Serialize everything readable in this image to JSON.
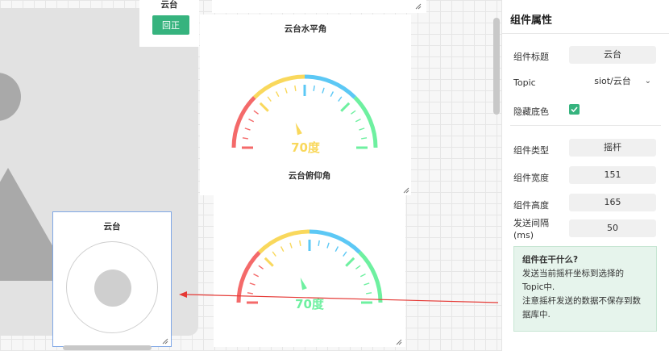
{
  "canvas": {
    "top_card": {
      "title": "云台",
      "reset_label": "回正"
    },
    "gauge_horizontal": {
      "title": "云台水平角",
      "value_text": "70度",
      "value": 70,
      "max": 180
    },
    "gauge_pitch": {
      "title": "云台俯仰角",
      "value_text": "70度",
      "value": 70,
      "max": 180
    },
    "joystick": {
      "title": "云台"
    }
  },
  "panel": {
    "title": "组件属性",
    "component_title": {
      "label": "组件标题",
      "value": "云台"
    },
    "topic": {
      "label": "Topic",
      "value": "siot/云台"
    },
    "hide_bg": {
      "label": "隐藏底色",
      "checked": true
    },
    "component_type": {
      "label": "组件类型",
      "value": "摇杆"
    },
    "width": {
      "label": "组件宽度",
      "value": "151"
    },
    "height": {
      "label": "组件高度",
      "value": "165"
    },
    "interval": {
      "label": "发送间隔",
      "label2": "(ms)",
      "value": "50"
    },
    "help": {
      "title": "组件在干什么?",
      "line1": "发送当前摇杆坐标到选择的",
      "line2": "Topic中.",
      "line3": "注意摇杆发送的数据不保存到数",
      "line4": "据库中."
    }
  },
  "colors": {
    "accent_green": "#36b37e",
    "gauge_red": "#f46a6a",
    "gauge_yellow": "#f9d85c",
    "gauge_blue": "#5cc8f5",
    "gauge_green": "#6ef0a0",
    "arrow_red": "#e53935"
  }
}
